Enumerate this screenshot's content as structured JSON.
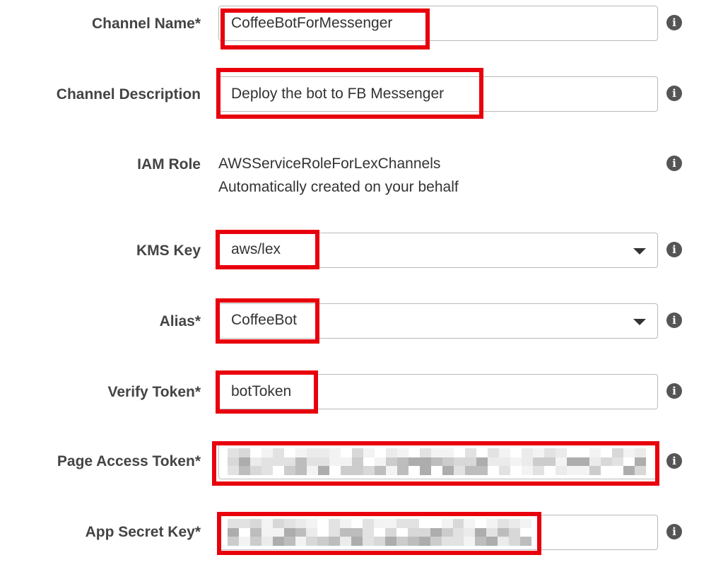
{
  "form": {
    "channel_name": {
      "label": "Channel Name*",
      "value": "CoffeeBotForMessenger"
    },
    "channel_description": {
      "label": "Channel Description",
      "value": "Deploy the bot to FB Messenger"
    },
    "iam_role": {
      "label": "IAM Role",
      "value": "AWSServiceRoleForLexChannels",
      "note": "Automatically created on your behalf"
    },
    "kms_key": {
      "label": "KMS Key",
      "value": "aws/lex"
    },
    "alias": {
      "label": "Alias*",
      "value": "CoffeeBot"
    },
    "verify_token": {
      "label": "Verify Token*",
      "value": "botToken"
    },
    "page_access_token": {
      "label": "Page Access Token*",
      "value": ""
    },
    "app_secret_key": {
      "label": "App Secret Key*",
      "value": ""
    }
  },
  "info_glyph": "i",
  "icons": {
    "info": "info-circle-icon",
    "dropdown": "caret-down-icon"
  },
  "colors": {
    "highlight": "#e8000d",
    "border": "#b9b9b9",
    "label": "#444444",
    "text": "#333333",
    "info": "#555555"
  }
}
